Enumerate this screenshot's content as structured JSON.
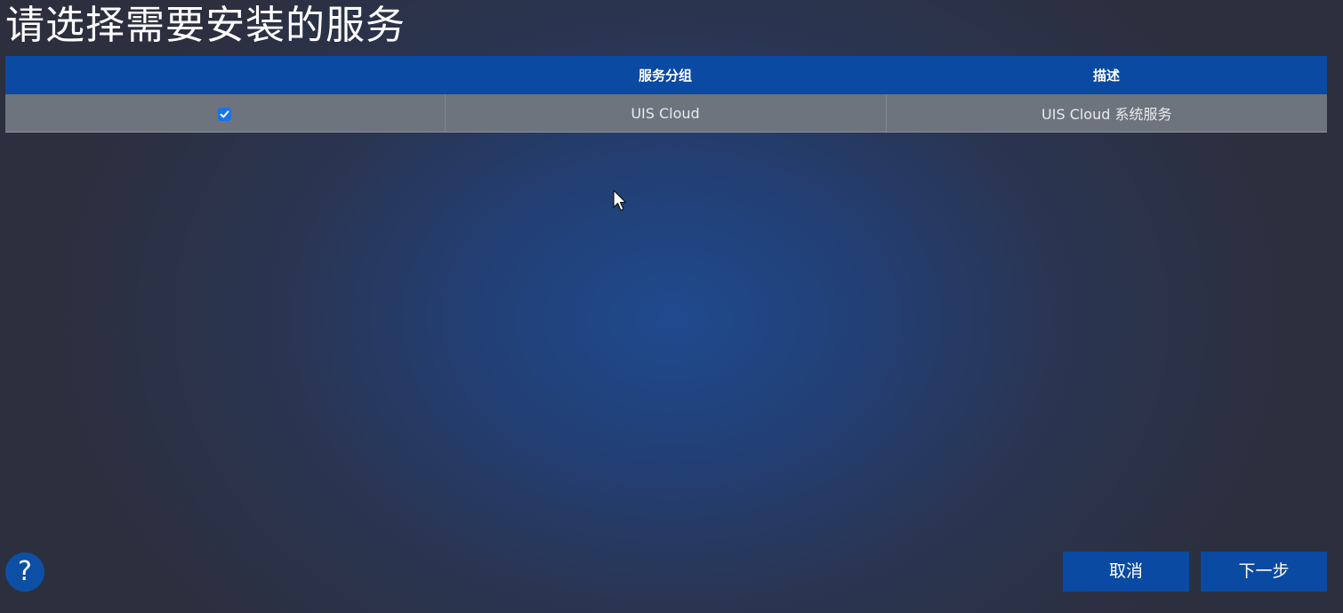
{
  "page": {
    "title": "请选择需要安装的服务"
  },
  "table": {
    "columns": [
      "",
      "服务分组",
      "描述"
    ],
    "rows": [
      {
        "checked": true,
        "group": "UIS Cloud",
        "description": "UIS Cloud 系统服务"
      }
    ]
  },
  "help": {
    "label": "?"
  },
  "footer": {
    "cancel_label": "取消",
    "next_label": "下一步"
  },
  "colors": {
    "header_bg": "#0a4aa3",
    "row_bg": "#6d747d",
    "checkbox_blue": "#1a73e8",
    "button_bg": "#0a4aa3"
  },
  "icons": {
    "checkbox": "checkmark-icon",
    "cursor": "mouse-pointer-icon",
    "help": "question-mark-icon"
  }
}
